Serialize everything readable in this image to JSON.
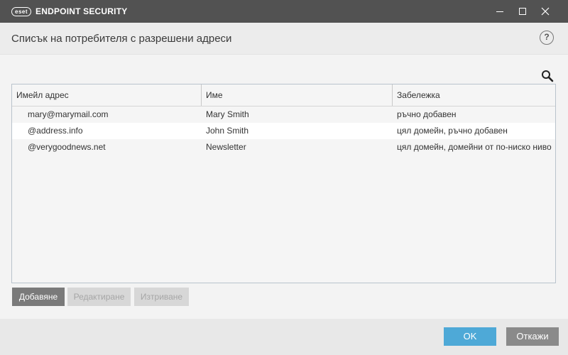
{
  "app": {
    "logo_mark": "eset",
    "title": "ENDPOINT SECURITY"
  },
  "window_controls": {
    "minimize_icon": "minimize-icon",
    "maximize_icon": "maximize-icon",
    "close_icon": "close-icon"
  },
  "header": {
    "title": "Списък на потребителя с разрешени адреси",
    "help_label": "?"
  },
  "search": {
    "icon": "search-icon"
  },
  "table": {
    "columns": [
      "Имейл адрес",
      "Име",
      "Забележка"
    ],
    "rows": [
      {
        "email": "mary@marymail.com",
        "name": "Mary Smith",
        "note": "ръчно добавен"
      },
      {
        "email": "@address.info",
        "name": "John Smith",
        "note": "цял домейн, ръчно добавен"
      },
      {
        "email": "@verygoodnews.net",
        "name": "Newsletter",
        "note": "цял домейн, домейни от по-ниско ниво"
      }
    ]
  },
  "actions": {
    "add_label": "Добавяне",
    "edit_label": "Редактиране",
    "delete_label": "Изтриване"
  },
  "footer": {
    "ok_label": "OK",
    "cancel_label": "Откажи"
  },
  "colors": {
    "titlebar": "#525252",
    "ok_button": "#4ea9d7",
    "cancel_button": "#8a8a8a",
    "add_button": "#7a7a7a"
  }
}
